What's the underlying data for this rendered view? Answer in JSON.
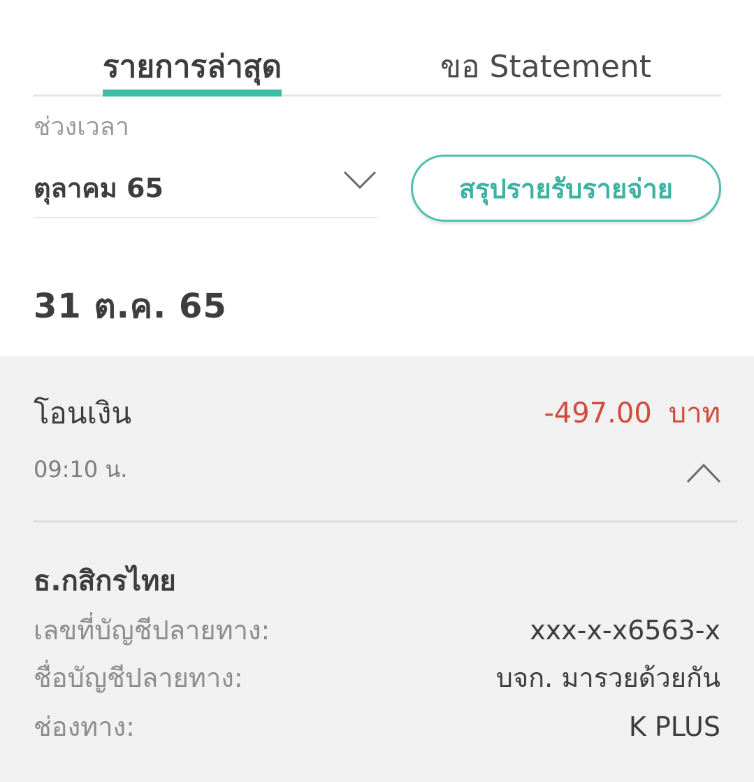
{
  "tabs": {
    "recent_label": "รายการล่าสุด",
    "statement_label": "ขอ Statement"
  },
  "filter": {
    "period_label": "ช่วงเวลา",
    "period_value": "ตุลาคม 65",
    "summary_button_label": "สรุปรายรับรายจ่าย"
  },
  "date_heading": "31 ต.ค. 65",
  "transaction": {
    "type": "โอนเงิน",
    "amount": "-497.00",
    "currency": "บาท",
    "time": "09:10 น.",
    "bank": "ธ.กสิกรไทย",
    "details": [
      {
        "label": "เลขที่บัญชีปลายทาง:",
        "value": "xxx-x-x6563-x"
      },
      {
        "label": "ชื่อบัญชีปลายทาง:",
        "value": "บจก. มารวยด้วยกัน"
      },
      {
        "label": "ช่องทาง:",
        "value": "K PLUS"
      }
    ]
  },
  "colors": {
    "accent": "#3fbca8",
    "negative_amount": "#d04b3b",
    "card_bg": "#f1f1f1"
  },
  "icons": {
    "period_dropdown": "chevron-down-icon",
    "collapse": "chevron-up-icon"
  }
}
